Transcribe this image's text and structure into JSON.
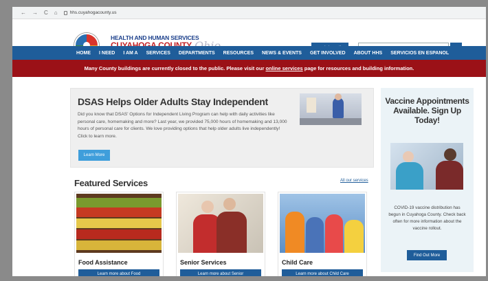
{
  "browser": {
    "url": "hhs.cuyahogacounty.us",
    "nav_glyphs": [
      "←",
      "→",
      "C",
      "⌂"
    ]
  },
  "header": {
    "brand_line1": "HEALTH AND HUMAN SERVICES",
    "brand_line2": "CUYAHOGA COUNTY,",
    "brand_line3": "Ohio",
    "social_media_label": "Social Media",
    "search_placeholder": "Insert Keyword to search"
  },
  "nav": {
    "items": [
      "HOME",
      "I NEED",
      "I AM A",
      "SERVICES",
      "DEPARTMENTS",
      "RESOURCES",
      "NEWS & EVENTS",
      "GET INVOLVED",
      "ABOUT HHS",
      "SERVICIOS EN ESPANOL"
    ]
  },
  "alert": {
    "prefix": "Many County buildings are currently closed to the public. Please visit our ",
    "link": "online services",
    "suffix": " page for resources and building information."
  },
  "feature": {
    "title": "DSAS Helps Older Adults Stay Independent",
    "body": "Did you know that DSAS' Options for Independent Living Program can help with daily activities like personal care, homemaking and more? Last year, we provided 75,000 hours of homemaking and 13,000 hours of personal care for clients. We love providing options that help older adults live independently! Click to learn more.",
    "button": "Learn More"
  },
  "featured_services": {
    "title": "Featured Services",
    "all_link": "All our services",
    "cards": [
      {
        "title": "Food Assistance",
        "button": "Learn more about Food"
      },
      {
        "title": "Senior Services",
        "button": "Learn more about Senior"
      },
      {
        "title": "Child Care",
        "button": "Learn more about Child Care"
      }
    ]
  },
  "vaccine": {
    "title": "Vaccine Appointments Available. Sign Up Today!",
    "body": "COVID-19 vaccine distribution has begun in Cuyahoga County. Check back often for more information about the vaccine rollout.",
    "button": "Find Out More"
  },
  "colors": {
    "nav_blue": "#1f5d9a",
    "alert_red": "#9b1117",
    "brand_red": "#c32428",
    "button_light_blue": "#3f9edb"
  }
}
